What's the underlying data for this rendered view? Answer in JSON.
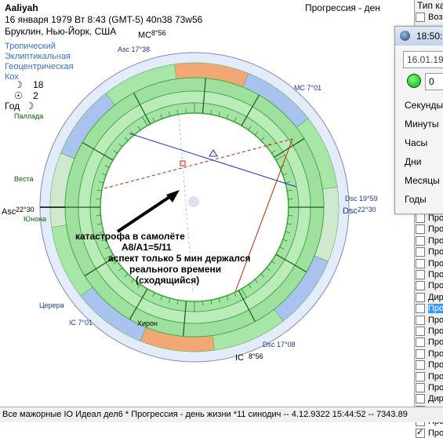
{
  "header": {
    "name": "Aaliyah",
    "datetime": "16 января 1979  Вт   8:43 (GMT-5) 40n38  73w56",
    "place": "Бруклин, Нью-Йорк, США"
  },
  "chart_meta": [
    "Тропический",
    "Эклиптикальная",
    "Геоцентрическая",
    "Кох"
  ],
  "legend": {
    "sun_count": "18",
    "circle_count": "2",
    "year_label": "Год"
  },
  "top_title": "Прогрессия - ден",
  "right_panel": {
    "tab_label": "Тип ка"
  },
  "dialog": {
    "title": "18:50:",
    "date_value": "16.01.197",
    "number_value": "0",
    "labels": [
      "Секунды",
      "Минуты",
      "Часы",
      "Дни",
      "Месяцы",
      "Годы"
    ],
    "options": [
      "Воз",
      "Про",
      "Про",
      "Про",
      "Про",
      "Про",
      "Про",
      "Про",
      "Дир",
      "Про",
      "Про",
      "Про",
      "Про",
      "Про",
      "Про",
      "Про",
      "Про",
      "Дир",
      "Про",
      "Про",
      "Про"
    ],
    "first_option": "Воз"
  },
  "annotation": {
    "line1": "катастрофа в самолёте",
    "line2": "A8/A1=5/11",
    "line3": "аспект только 5 мин держался",
    "line4": "реального времени",
    "line5": "(сходящийся)"
  },
  "angles": {
    "asc": "Asc",
    "asc_deg": "22°30",
    "dsc": "Dsc",
    "dsc_deg": "22°30",
    "mc": "MC",
    "mc_deg": "8°56",
    "ic": "IC",
    "ic_deg": "8°56"
  },
  "chart_labels": [
    "Asc 17°38",
    "Паллада",
    "Веста",
    "Юнона",
    "Церера",
    "Хирон",
    "Dsc 17°08",
    "IC 7°01",
    "MC 7°01",
    "Dsc 19°59"
  ],
  "colors": {
    "ring_green": "#a8e6a8",
    "ring_blue": "#a9c3ee",
    "ring_orange": "#f2a874",
    "line_red": "#cc2200",
    "line_blue": "#2233cc"
  },
  "status": {
    "text": "Все мажорные  IO Идеал дел6  *  Прогрессия - день жизни *11 синодич -- 4.12.9322 15:44:52 -- 7343.89"
  }
}
